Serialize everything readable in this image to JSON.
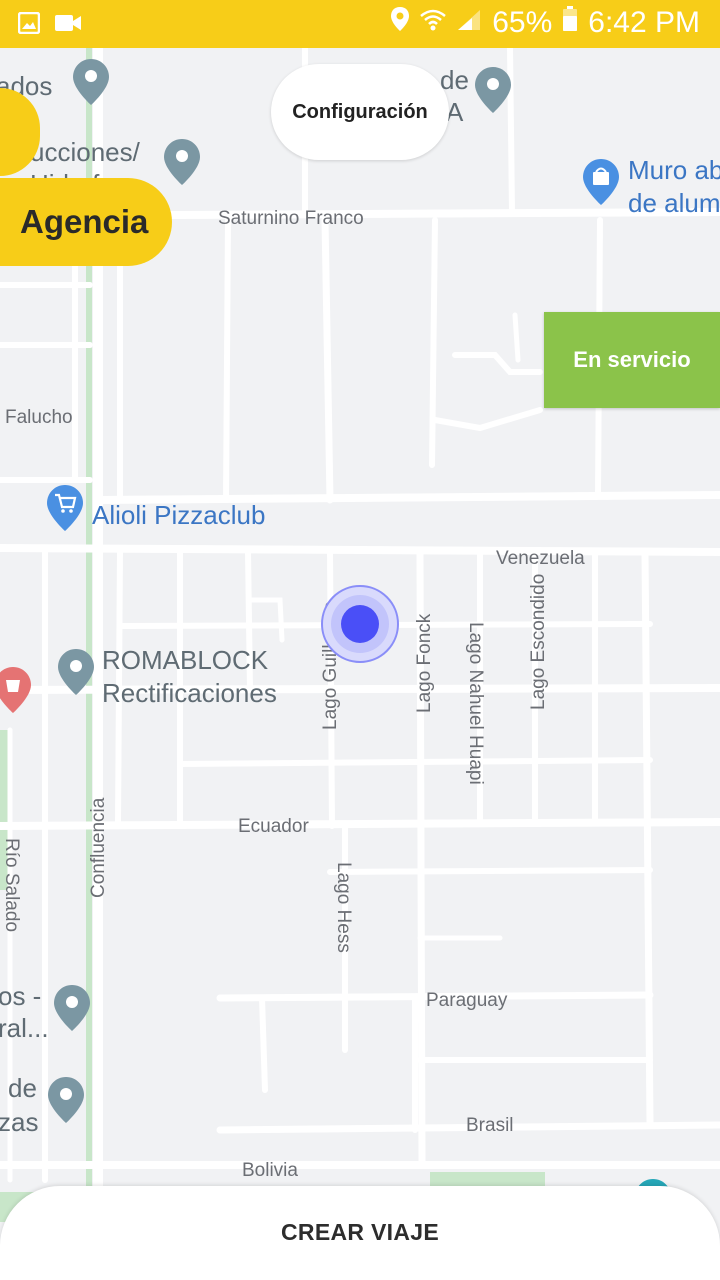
{
  "status_bar": {
    "battery": "65%",
    "time": "6:42 PM",
    "icons": [
      "gallery-icon",
      "video-icon",
      "location-icon",
      "wifi-icon",
      "signal-icon",
      "battery-icon"
    ]
  },
  "buttons": {
    "configuration": "Configuración",
    "agency": "Agencia",
    "in_service": "En servicio",
    "create_trip": "CREAR VIAJE"
  },
  "colors": {
    "accent_yellow": "#f7cd18",
    "service_green": "#8bc34a",
    "location_blue": "#4a4ff7",
    "pin_gray": "#7b97a3",
    "pin_blue": "#4a90e2",
    "pin_red": "#e57373"
  },
  "map": {
    "streets": {
      "saturnino_franco": "Saturnino Franco",
      "falucho": "Falucho",
      "venezuela": "Venezuela",
      "ecuador": "Ecuador",
      "paraguay": "Paraguay",
      "brasil": "Brasil",
      "bolivia": "Bolivia",
      "confluencia": "Confluencia",
      "rio_salado": "Río Salado",
      "lago_guillermo": "Lago Guillermo",
      "lago_fonck": "Lago Fonck",
      "lago_nahuel_huapi": "Lago Nahuel Huapi",
      "lago_escondido": "Lago Escondido",
      "lago_hess": "Lago Hess"
    },
    "pois": {
      "top_left": "ados",
      "top_center_1": "de",
      "top_center_2": "A",
      "construcciones_1": "ucciones/",
      "construcciones_2": "Hidrofo",
      "muro_1": "Muro ab",
      "muro_2": "de alum",
      "alioli": "Alioli Pizzaclub",
      "romablock_1": "ROMABLOCK",
      "romablock_2": "Rectificaciones",
      "left_mid_1": "os -",
      "left_mid_2": "ral...",
      "left_low_1": "de",
      "left_low_2": "zas"
    }
  }
}
